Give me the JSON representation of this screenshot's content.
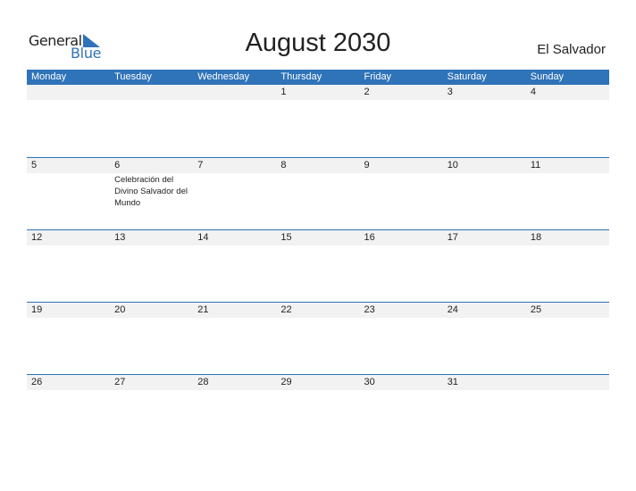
{
  "logo": {
    "general": "General",
    "blue": "Blue"
  },
  "title": "August 2030",
  "country": "El Salvador",
  "colors": {
    "accent": "#2f73b9",
    "strip": "#f2f2f2"
  },
  "weekdays": [
    "Monday",
    "Tuesday",
    "Wednesday",
    "Thursday",
    "Friday",
    "Saturday",
    "Sunday"
  ],
  "weeks": [
    {
      "days": [
        "",
        "",
        "",
        "1",
        "2",
        "3",
        "4"
      ],
      "events": [
        "",
        "",
        "",
        "",
        "",
        "",
        ""
      ]
    },
    {
      "days": [
        "5",
        "6",
        "7",
        "8",
        "9",
        "10",
        "11"
      ],
      "events": [
        "",
        "Celebración del Divino Salvador del Mundo",
        "",
        "",
        "",
        "",
        ""
      ]
    },
    {
      "days": [
        "12",
        "13",
        "14",
        "15",
        "16",
        "17",
        "18"
      ],
      "events": [
        "",
        "",
        "",
        "",
        "",
        "",
        ""
      ]
    },
    {
      "days": [
        "19",
        "20",
        "21",
        "22",
        "23",
        "24",
        "25"
      ],
      "events": [
        "",
        "",
        "",
        "",
        "",
        "",
        ""
      ]
    },
    {
      "days": [
        "26",
        "27",
        "28",
        "29",
        "30",
        "31",
        ""
      ],
      "events": [
        "",
        "",
        "",
        "",
        "",
        "",
        ""
      ]
    }
  ]
}
